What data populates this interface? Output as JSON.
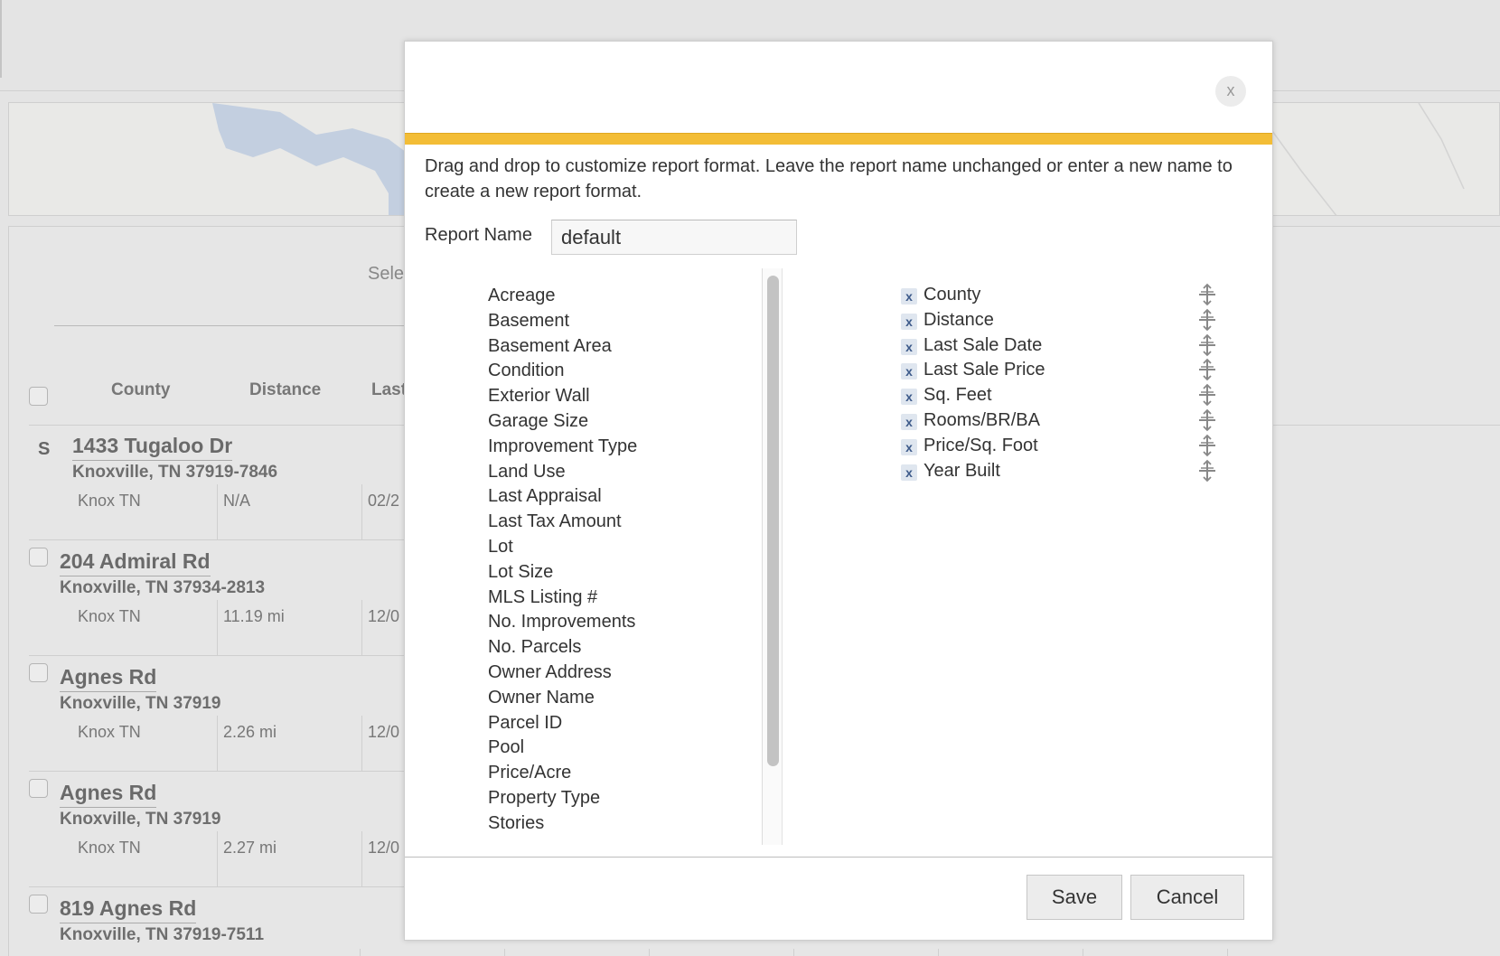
{
  "background": {
    "select_text": "Sele",
    "columns": [
      "County",
      "Distance",
      "Last"
    ],
    "listings": [
      {
        "letter": "S",
        "address": "1433 Tugaloo Dr",
        "city": "Knoxville, TN 37919-7846",
        "county": "Knox TN",
        "distance": "N/A",
        "last": "02/2"
      },
      {
        "letter": "",
        "address": "204 Admiral Rd",
        "city": "Knoxville, TN 37934-2813",
        "county": "Knox TN",
        "distance": "11.19 mi",
        "last": "12/0"
      },
      {
        "letter": "",
        "address": "Agnes Rd",
        "city": "Knoxville, TN 37919",
        "county": "Knox TN",
        "distance": "2.26 mi",
        "last": "12/0"
      },
      {
        "letter": "",
        "address": "Agnes Rd",
        "city": "Knoxville, TN 37919",
        "county": "Knox TN",
        "distance": "2.27 mi",
        "last": "12/0"
      },
      {
        "letter": "",
        "address": "819 Agnes Rd",
        "city": "Knoxville, TN 37919-7511",
        "county": "",
        "distance": "",
        "last": ""
      }
    ]
  },
  "modal": {
    "close_label": "x",
    "description": "Drag and drop to customize report format. Leave the report name unchanged or enter a new name to create a new report format.",
    "report_name_label": "Report Name",
    "report_name_value": "default",
    "available_fields": [
      "Acreage",
      "Basement",
      "Basement Area",
      "Condition",
      "Exterior Wall",
      "Garage Size",
      "Improvement Type",
      "Land Use",
      "Last Appraisal",
      "Last Tax Amount",
      "Lot",
      "Lot Size",
      "MLS Listing #",
      "No. Improvements",
      "No. Parcels",
      "Owner Address",
      "Owner Name",
      "Parcel ID",
      "Pool",
      "Price/Acre",
      "Property Type",
      "Stories"
    ],
    "selected_fields": [
      "County",
      "Distance",
      "Last Sale Date",
      "Last Sale Price",
      "Sq. Feet",
      "Rooms/BR/BA",
      "Price/Sq. Foot",
      "Year Built"
    ],
    "remove_label": "x",
    "save_label": "Save",
    "cancel_label": "Cancel",
    "accent_color": "#f3bd36"
  }
}
